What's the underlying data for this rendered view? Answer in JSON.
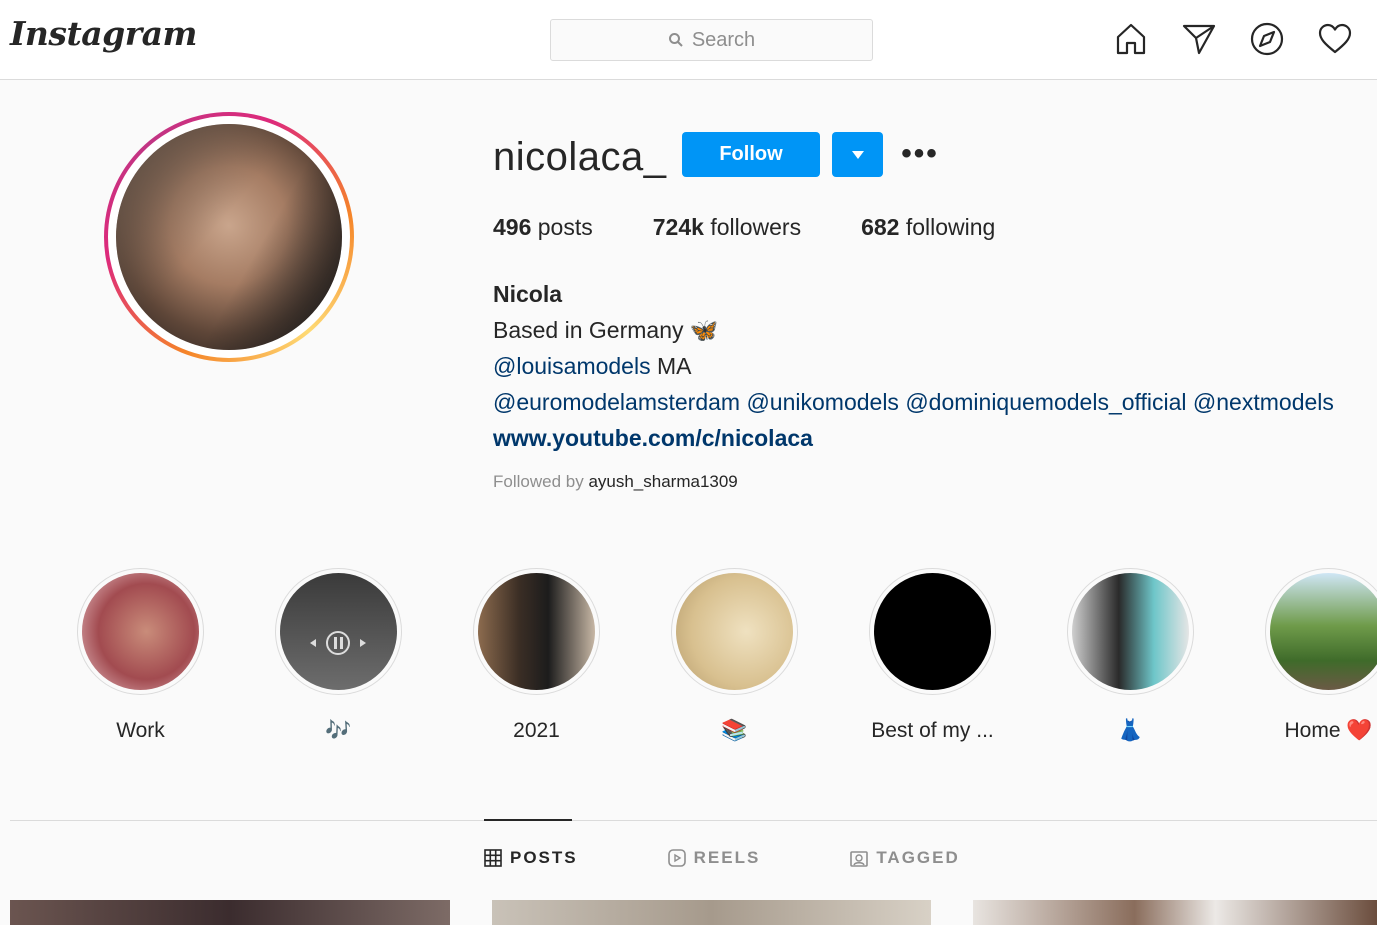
{
  "header": {
    "logo": "Instagram",
    "search_placeholder": "Search",
    "nav_icons": [
      "home-icon",
      "direct-icon",
      "explore-icon",
      "activity-heart-icon"
    ]
  },
  "profile": {
    "username": "nicolaca_",
    "follow_label": "Follow",
    "more_label": "•••",
    "stats": {
      "posts_count": "496",
      "posts_label": "posts",
      "followers_count": "724k",
      "followers_label": "followers",
      "following_count": "682",
      "following_label": "following"
    },
    "bio": {
      "name": "Nicola",
      "line1": "Based in Germany 🦋",
      "agency": "@louisamodels",
      "agency_suffix": " MA",
      "mentions": [
        "@euromodelamsterdam",
        "@unikomodels",
        "@dominiquemodels_official",
        "@nextmodels"
      ],
      "website": "www.youtube.com/c/nicolaca"
    },
    "followed_by_prefix": "Followed by ",
    "followed_by_user": "ayush_sharma1309"
  },
  "highlights": [
    {
      "label": "Work"
    },
    {
      "label": "🎶"
    },
    {
      "label": "2021"
    },
    {
      "label": "📚"
    },
    {
      "label": "Best of my ..."
    },
    {
      "label": "👗"
    },
    {
      "label": "Home ❤️"
    }
  ],
  "tabs": [
    {
      "label": "POSTS",
      "active": true
    },
    {
      "label": "REELS",
      "active": false
    },
    {
      "label": "TAGGED",
      "active": false
    }
  ],
  "colors": {
    "accent": "#0095f6",
    "link": "#00376b",
    "ring_start": "#f58529",
    "ring_end": "#dd2a7b"
  }
}
